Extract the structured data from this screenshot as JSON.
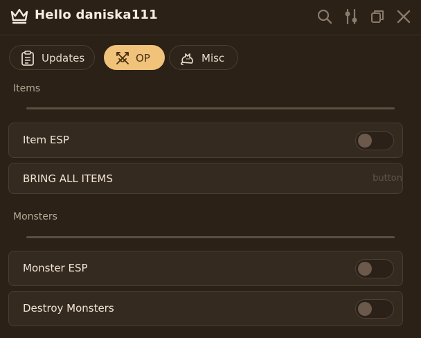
{
  "window": {
    "title": "Hello daniska111"
  },
  "titlebar": {
    "icons": [
      "crown-icon",
      "search-icon",
      "sliders-icon",
      "copy-icon",
      "close-icon"
    ]
  },
  "tabs": [
    {
      "label": "Updates",
      "icon": "clipboard-icon",
      "active": false
    },
    {
      "label": "OP",
      "icon": "crossed-swords-icon",
      "active": true
    },
    {
      "label": "Misc",
      "icon": "cat-icon",
      "active": false
    }
  ],
  "sections": {
    "items": {
      "label": "Items",
      "toggle_item_esp": {
        "label": "Item ESP",
        "on": false
      },
      "bring_all": {
        "label": "BRING ALL ITEMS",
        "hint": "button"
      }
    },
    "monsters": {
      "label": "Monsters",
      "toggle_monster_esp": {
        "label": "Monster ESP",
        "on": false
      },
      "toggle_destroy": {
        "label": "Destroy Monsters",
        "on": false
      }
    }
  },
  "colors": {
    "background": "#2b2117",
    "row": "#352a1f",
    "accent": "#f0c27a",
    "text": "#f1e4d4"
  }
}
